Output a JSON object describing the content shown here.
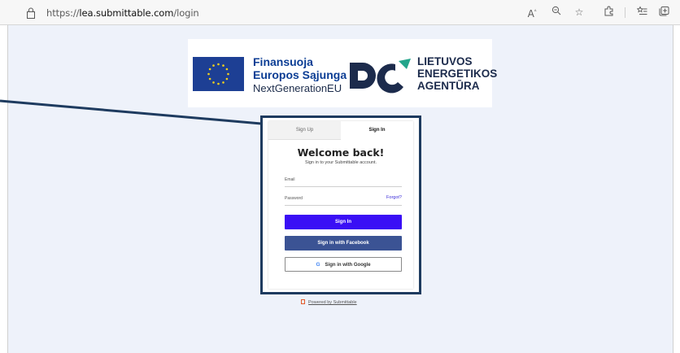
{
  "browser": {
    "url_prefix": "https://",
    "url_domain": "lea.submittable.com",
    "url_path": "/login",
    "toolbar_icons": [
      "read-aloud-icon",
      "zoom-icon",
      "add-favorite-icon",
      "extensions-icon",
      "favorites-icon",
      "collections-icon"
    ]
  },
  "banner": {
    "eu_line1": "Finansuoja",
    "eu_line2": "Europos Sąjunga",
    "eu_line3": "NextGenerationEU",
    "lea_line1": "LIETUVOS",
    "lea_line2": "ENERGETIKOS",
    "lea_line3": "AGENTŪRA"
  },
  "login": {
    "tab_signup": "Sign Up",
    "tab_signin": "Sign In",
    "title": "Welcome back!",
    "subtitle": "Sign in to your Submittable account.",
    "email_label": "Email",
    "password_label": "Password",
    "forgot": "Forgot?",
    "signin_button": "Sign In",
    "facebook_button": "Sign in with Facebook",
    "google_button": "Sign in with Google",
    "google_icon": "G"
  },
  "footer": {
    "powered": "Powered by Submittable"
  },
  "colors": {
    "signin_button": "#3a0ff5",
    "facebook_button": "#3b5394",
    "annotation": "#1e3b5f",
    "eu_blue": "#1d3f94"
  }
}
